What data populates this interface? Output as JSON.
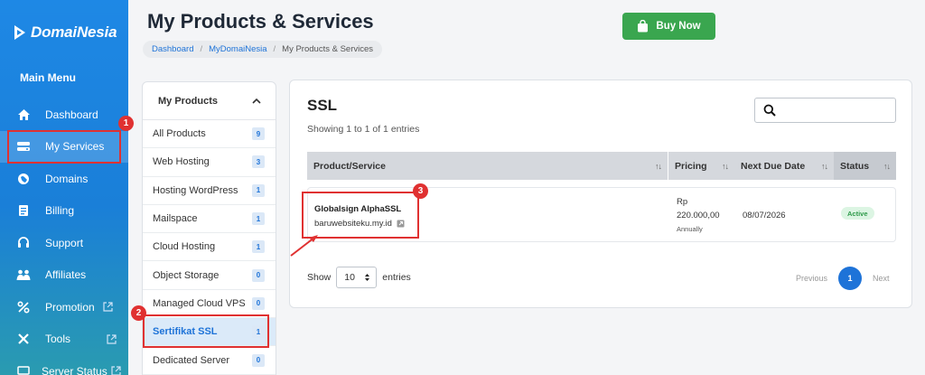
{
  "brand": {
    "name": "DomaiNesia"
  },
  "sidebar": {
    "menu_title": "Main Menu",
    "items": [
      {
        "label": "Dashboard",
        "icon": "home-icon"
      },
      {
        "label": "My Services",
        "icon": "server-icon",
        "active": true
      },
      {
        "label": "Domains",
        "icon": "globe-icon"
      },
      {
        "label": "Billing",
        "icon": "invoice-icon"
      },
      {
        "label": "Support",
        "icon": "headset-icon"
      },
      {
        "label": "Affiliates",
        "icon": "handshake-icon"
      },
      {
        "label": "Promotion",
        "icon": "percent-icon",
        "external": true
      },
      {
        "label": "Tools",
        "icon": "tools-icon",
        "external": true
      },
      {
        "label": "Server Status",
        "icon": "monitor-icon",
        "external": true
      }
    ]
  },
  "header": {
    "title": "My Products & Services",
    "breadcrumb": [
      "Dashboard",
      "MyDomaiNesia",
      "My Products & Services"
    ],
    "buy_label": "Buy Now"
  },
  "products_panel": {
    "title": "My Products",
    "items": [
      {
        "label": "All Products",
        "count": "9"
      },
      {
        "label": "Web Hosting",
        "count": "3"
      },
      {
        "label": "Hosting WordPress",
        "count": "1"
      },
      {
        "label": "Mailspace",
        "count": "1"
      },
      {
        "label": "Cloud Hosting",
        "count": "1"
      },
      {
        "label": "Object Storage",
        "count": "0"
      },
      {
        "label": "Managed Cloud VPS",
        "count": "0"
      },
      {
        "label": "Sertifikat SSL",
        "count": "1",
        "active": true
      },
      {
        "label": "Dedicated Server",
        "count": "0"
      }
    ]
  },
  "main": {
    "section_title": "SSL",
    "showing": "Showing 1 to 1 of 1 entries",
    "columns": [
      "Product/Service",
      "Pricing",
      "Next Due Date",
      "Status"
    ],
    "rows": [
      {
        "product": "Globalsign AlphaSSL",
        "domain": "baruwebsiteku.my.id",
        "price_currency": "Rp",
        "price_amount": "220.000,00",
        "cycle": "Annually",
        "due": "08/07/2026",
        "status": "Active"
      }
    ],
    "show_label": "Show",
    "page_size": "10",
    "entries_label": "entries",
    "pager": {
      "previous": "Previous",
      "current": "1",
      "next": "Next"
    }
  },
  "annotations": {
    "step1": "1",
    "step2": "2",
    "step3": "3",
    "color": "#e03131"
  },
  "colors": {
    "accent": "#1e73d8",
    "buy": "#3aa64f",
    "sidebar": "#1e88e5",
    "active_badge": "#2e9a4a"
  }
}
